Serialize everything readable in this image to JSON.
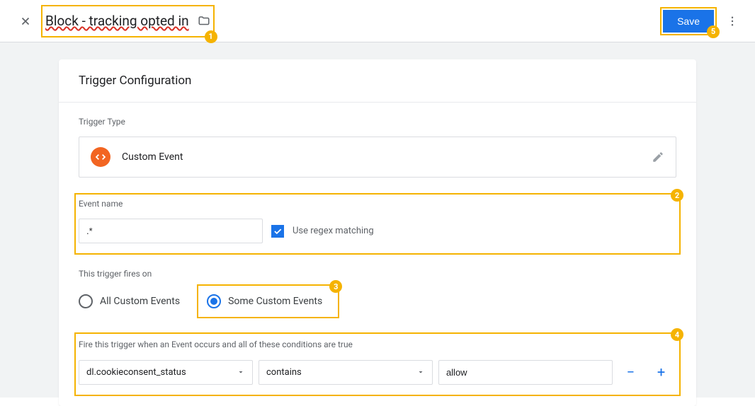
{
  "header": {
    "title": "Block - tracking opted in",
    "save_label": "Save"
  },
  "config": {
    "heading": "Trigger Configuration",
    "type_label": "Trigger Type",
    "type_name": "Custom Event",
    "event_name_label": "Event name",
    "event_name_value": ".*",
    "regex_label": "Use regex matching",
    "fires_on_label": "This trigger fires on",
    "radio": {
      "all": "All Custom Events",
      "some": "Some Custom Events"
    },
    "condition_label": "Fire this trigger when an Event occurs and all of these conditions are true",
    "condition": {
      "variable": "dl.cookieconsent_status",
      "operator": "contains",
      "value": "allow"
    }
  },
  "annotations": {
    "b1": "1",
    "b2": "2",
    "b3": "3",
    "b4": "4",
    "b5": "5"
  }
}
